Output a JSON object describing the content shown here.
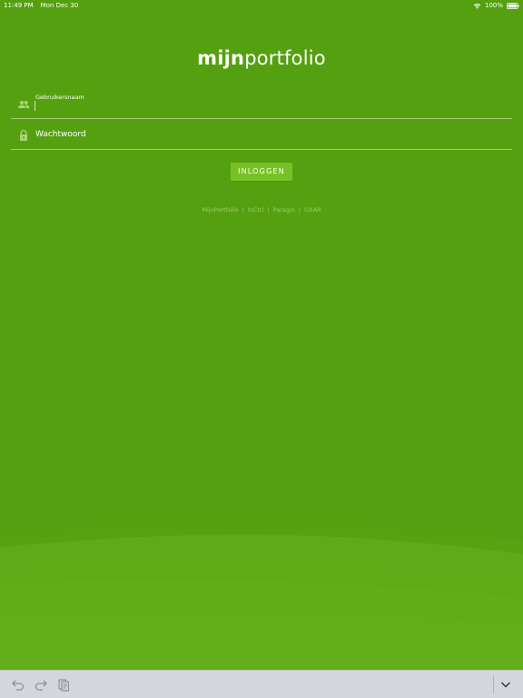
{
  "status_bar": {
    "time": "11:49 PM",
    "date": "Mon Dec 30",
    "battery": "100%"
  },
  "logo": {
    "bold": "mijn",
    "light": "portfolio"
  },
  "form": {
    "username_label": "Gebruikersnaam",
    "username_value": "",
    "password_placeholder": "Wachtwoord",
    "login_button": "INLOGGEN"
  },
  "links": [
    "MijnPortfolio",
    "InCtrl",
    "Paragin",
    "GXAR"
  ],
  "links_separator": "|",
  "colors": {
    "background": "#55a010",
    "button": "#77c127",
    "toolbar": "#d4d6dc"
  },
  "icons": {
    "user": "users-icon",
    "password": "lock-icon",
    "undo": "undo-icon",
    "redo": "redo-icon",
    "paste": "paste-icon",
    "dismiss": "chevron-down-icon"
  }
}
